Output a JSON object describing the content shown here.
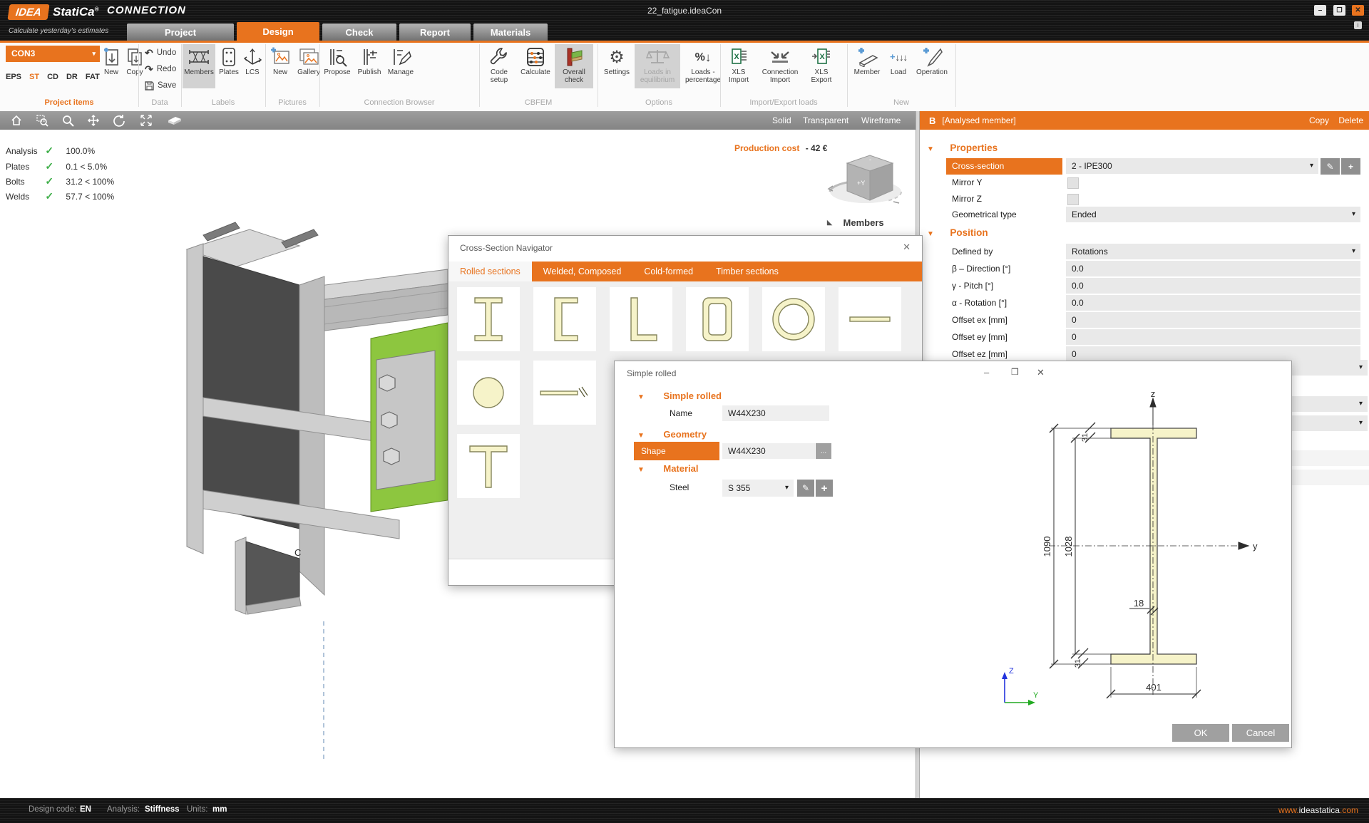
{
  "titlebar": {
    "logo_idea": "IDEA",
    "logo_statica": "StatiCa",
    "logo_reg": "®",
    "product": "CONNECTION",
    "tagline": "Calculate yesterday's estimates",
    "document_title": "22_fatigue.ideaCon",
    "minimize_glyph": "–",
    "maximize_glyph": "❒",
    "close_glyph": "✕"
  },
  "tabs": {
    "items": [
      {
        "label": "Project"
      },
      {
        "label": "Design"
      },
      {
        "label": "Check"
      },
      {
        "label": "Report"
      },
      {
        "label": "Materials"
      }
    ],
    "active": "Design"
  },
  "ribbon": {
    "project_items": {
      "group_label": "Project items",
      "selector": "CON3",
      "modes": [
        {
          "label": "EPS"
        },
        {
          "label": "ST"
        },
        {
          "label": "CD"
        },
        {
          "label": "DR"
        },
        {
          "label": "FAT"
        }
      ],
      "active_mode": "ST",
      "new_label": "New",
      "copy_label": "Copy"
    },
    "data_group": {
      "group_label": "Data",
      "undo": "Undo",
      "redo": "Redo",
      "save": "Save",
      "undo_glyph": "↶",
      "redo_glyph": "↷"
    },
    "labels_group": {
      "group_label": "Labels",
      "members": "Members",
      "plates": "Plates",
      "lcs": "LCS"
    },
    "pictures": {
      "group_label": "Pictures",
      "new_label": "New",
      "gallery": "Gallery"
    },
    "browser": {
      "group_label": "Connection Browser",
      "propose": "Propose",
      "publish": "Publish",
      "manage": "Manage"
    },
    "cbfem": {
      "group_label": "CBFEM",
      "code_setup": "Code setup",
      "calculate": "Calculate",
      "overall_check": "Overall check"
    },
    "options": {
      "group_label": "Options",
      "settings": "Settings",
      "loads_eq": "Loads in equilibrium",
      "loads_pct": "Loads - percentage",
      "gear_glyph": "⚙",
      "pct_glyph": "%",
      "arrow_glyph": "↓"
    },
    "import_export": {
      "group_label": "Import/Export loads",
      "xls_import": "XLS Import",
      "conn_import": "Connection Import",
      "xls_export": "XLS Export"
    },
    "new_group": {
      "group_label": "New",
      "member": "Member",
      "load": "Load",
      "operation": "Operation",
      "load_glyph": "↓↓↓"
    }
  },
  "viewport": {
    "display_modes": [
      {
        "label": "Solid"
      },
      {
        "label": "Transparent"
      },
      {
        "label": "Wireframe"
      }
    ],
    "check_glyph": "✓",
    "checks": [
      {
        "name": "Analysis",
        "value": "100.0%"
      },
      {
        "name": "Plates",
        "value": "0.1 < 5.0%"
      },
      {
        "name": "Bolts",
        "value": "31.2 < 100%"
      },
      {
        "name": "Welds",
        "value": "57.7 < 100%"
      }
    ],
    "production_cost_label": "Production cost",
    "production_cost_value": "-  42 €",
    "members_header": "Members",
    "members_collapse_glyph": "◣",
    "member_label": "C",
    "nav_cube_label": "+Y"
  },
  "panel": {
    "letter": "B",
    "title": "[Analysed member]",
    "copy_label": "Copy",
    "delete_label": "Delete",
    "properties_header": "Properties",
    "position_header": "Position",
    "rows": [
      {
        "label": "Cross-section",
        "value": "2 - IPE300"
      },
      {
        "label": "Mirror Y"
      },
      {
        "label": "Mirror Z"
      },
      {
        "label": "Geometrical type",
        "value": "Ended"
      },
      {
        "label": "Defined by",
        "value": "Rotations"
      },
      {
        "label": "β – Direction [°]",
        "value": "0.0"
      },
      {
        "label": "γ - Pitch [°]",
        "value": "0.0"
      },
      {
        "label": "α - Rotation [°]",
        "value": "0.0"
      },
      {
        "label": "Offset ex [mm]",
        "value": "0"
      },
      {
        "label": "Offset ey [mm]",
        "value": "0"
      },
      {
        "label": "Offset ez [mm]",
        "value": "0"
      }
    ],
    "edit_glyph": "✎",
    "add_glyph": "+"
  },
  "navigator": {
    "title": "Cross-Section Navigator",
    "close_glyph": "✕",
    "tabs": [
      {
        "label": "Rolled sections"
      },
      {
        "label": "Welded, Composed"
      },
      {
        "label": "Cold-formed"
      },
      {
        "label": "Timber sections"
      }
    ],
    "active_tab": "Rolled sections"
  },
  "simple_rolled": {
    "window_title": "Simple rolled",
    "minimize_glyph": "–",
    "maximize_glyph": "❒",
    "close_glyph": "✕",
    "section_main": "Simple rolled",
    "section_geometry": "Geometry",
    "section_material": "Material",
    "name_label": "Name",
    "name_value": "W44X230",
    "shape_label": "Shape",
    "shape_value": "W44X230",
    "browse_glyph": "...",
    "steel_label": "Steel",
    "steel_value": "S 355",
    "edit_glyph": "✎",
    "add_glyph": "+",
    "ok_label": "OK",
    "cancel_label": "Cancel",
    "drawing": {
      "dim_height": "1090",
      "dim_inner": "1028",
      "dim_flange_top": "31",
      "dim_flange_bottom": "31",
      "dim_web": "18",
      "dim_width": "401",
      "axis_z": "z",
      "axis_y": "y",
      "triad_z": "Z",
      "triad_y": "Y"
    }
  },
  "statusbar": {
    "design_code_label": "Design code:",
    "design_code": "EN",
    "analysis_label": "Analysis:",
    "analysis": "Stiffness",
    "units_label": "Units:",
    "units": "mm",
    "website_prefix": "www.",
    "website_mid": "ideastatica",
    "website_suffix": ".com"
  },
  "colors": {
    "accent": "#e8731e",
    "model_highlight": "#8dc63f",
    "check_green": "#3fae49",
    "section_fill": "#f6f3c9"
  }
}
